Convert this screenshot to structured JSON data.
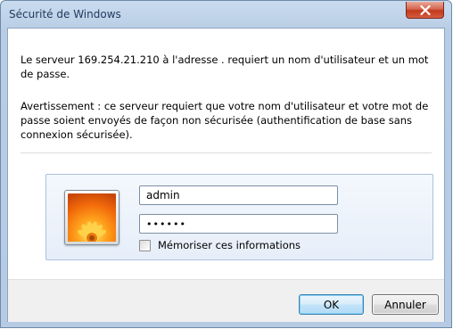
{
  "window": {
    "title": "Sécurité de Windows",
    "close_icon": "close-x-icon"
  },
  "message": {
    "line1": "Le serveur 169.254.21.210 à l'adresse . requiert un nom d'utilisateur et un mot de passe.",
    "line2": "Avertissement : ce serveur requiert que votre nom d'utilisateur et votre mot de passe soient envoyés de façon non sécurisée (authentification de base sans connexion sécurisée)."
  },
  "credentials": {
    "avatar_icon": "flower-user-tile-icon",
    "username_value": "admin",
    "password_value": "••••••",
    "remember_label": "Mémoriser ces informations",
    "remember_checked": false
  },
  "buttons": {
    "ok_label": "OK",
    "cancel_label": "Annuler"
  },
  "colors": {
    "frame": "#b8cde5",
    "title_text": "#1e395b",
    "close_button": "#c2391c",
    "panel_border": "#a9c2e0",
    "default_button_border": "#3c7fb1"
  }
}
